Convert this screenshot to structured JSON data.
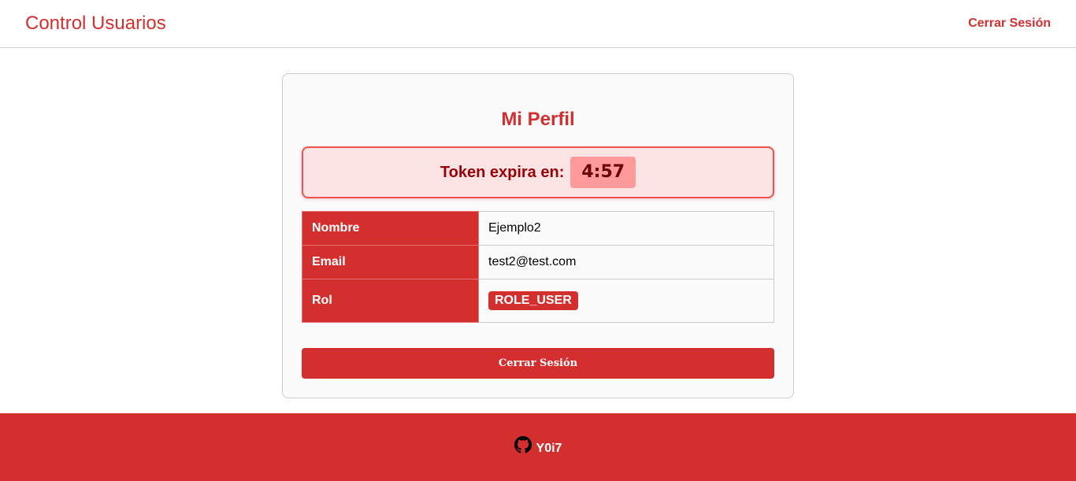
{
  "header": {
    "brand": "Control Usuarios",
    "logout_label": "Cerrar Sesión"
  },
  "profile": {
    "title": "Mi Perfil",
    "token_label": "Token expira en:",
    "token_time": "4:57",
    "rows": [
      {
        "key": "Nombre",
        "value": "Ejemplo2"
      },
      {
        "key": "Email",
        "value": "test2@test.com"
      },
      {
        "key": "Rol",
        "value": "ROLE_USER"
      }
    ],
    "logout_button": "Cerrar Sesión"
  },
  "footer": {
    "icon": "github-icon",
    "username": "Y0i7"
  },
  "colors": {
    "primary": "#d32f2f",
    "token_bg": "#fde4e4",
    "token_border": "#ef5350",
    "token_time_bg": "#ff9a9a"
  }
}
